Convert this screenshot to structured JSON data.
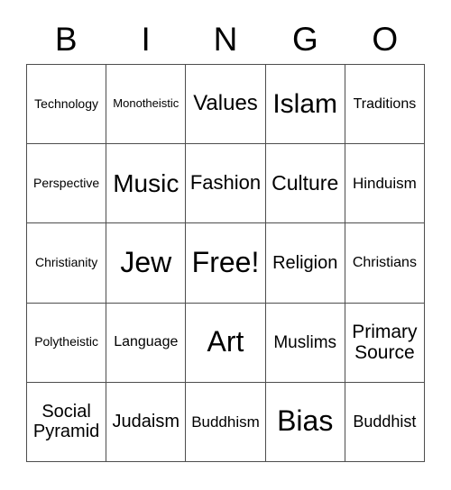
{
  "card": {
    "title": "BINGO",
    "header_letters": [
      "B",
      "I",
      "N",
      "G",
      "O"
    ],
    "rows": 5,
    "columns": 5,
    "border_color": "#4d4d4d",
    "background_color": "#ffffff",
    "text_color": "#000000",
    "free_space_label": "Free!",
    "free_space_index": 12,
    "cells": [
      {
        "label": "Technology",
        "marked": false
      },
      {
        "label": "Monotheistic",
        "marked": false
      },
      {
        "label": "Values",
        "marked": false
      },
      {
        "label": "Islam",
        "marked": false
      },
      {
        "label": "Traditions",
        "marked": false
      },
      {
        "label": "Perspective",
        "marked": false
      },
      {
        "label": "Music",
        "marked": false
      },
      {
        "label": "Fashion",
        "marked": false
      },
      {
        "label": "Culture",
        "marked": false
      },
      {
        "label": "Hinduism",
        "marked": false
      },
      {
        "label": "Christianity",
        "marked": false
      },
      {
        "label": "Jew",
        "marked": false
      },
      {
        "label": "Free!",
        "marked": false
      },
      {
        "label": "Religion",
        "marked": false
      },
      {
        "label": "Christians",
        "marked": false
      },
      {
        "label": "Polytheistic",
        "marked": false
      },
      {
        "label": "Language",
        "marked": false
      },
      {
        "label": "Art",
        "marked": false
      },
      {
        "label": "Muslims",
        "marked": false
      },
      {
        "label": "Primary\nSource",
        "marked": false
      },
      {
        "label": "Social\nPyramid",
        "marked": false
      },
      {
        "label": "Judaism",
        "marked": false
      },
      {
        "label": "Buddhism",
        "marked": false
      },
      {
        "label": "Bias",
        "marked": false
      },
      {
        "label": "Buddhist",
        "marked": false
      }
    ]
  }
}
